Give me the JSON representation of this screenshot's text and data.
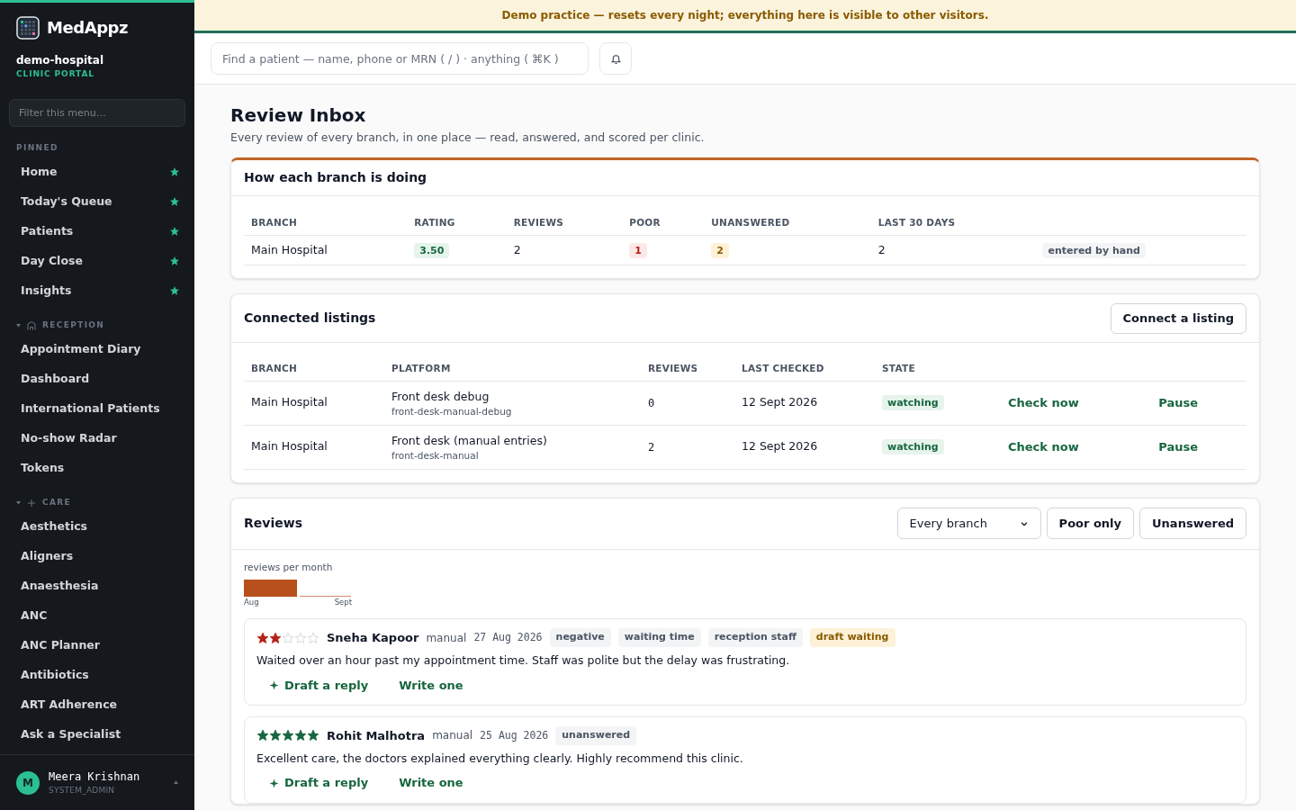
{
  "sidebar": {
    "brand": "MedAppz",
    "org": "demo-hospital",
    "portal": "CLINIC PORTAL",
    "filter_placeholder": "Filter this menu…",
    "sections": [
      {
        "title": "PINNED",
        "kind": "pinned",
        "items": [
          {
            "label": "Home",
            "pinned": true
          },
          {
            "label": "Today's Queue",
            "pinned": true
          },
          {
            "label": "Patients",
            "pinned": true
          },
          {
            "label": "Day Close",
            "pinned": true
          },
          {
            "label": "Insights",
            "pinned": true
          }
        ]
      },
      {
        "title": "RECEPTION",
        "kind": "reception",
        "expanded": true,
        "items": [
          {
            "label": "Appointment Diary"
          },
          {
            "label": "Dashboard"
          },
          {
            "label": "International Patients"
          },
          {
            "label": "No-show Radar"
          },
          {
            "label": "Tokens"
          }
        ]
      },
      {
        "title": "CARE",
        "kind": "care",
        "expanded": true,
        "items": [
          {
            "label": "Aesthetics"
          },
          {
            "label": "Aligners"
          },
          {
            "label": "Anaesthesia"
          },
          {
            "label": "ANC"
          },
          {
            "label": "ANC Planner"
          },
          {
            "label": "Antibiotics"
          },
          {
            "label": "ART Adherence"
          },
          {
            "label": "Ask a Specialist"
          }
        ]
      }
    ],
    "user": {
      "initial": "M",
      "name": "Meera Krishnan",
      "role": "SYSTEM_ADMIN"
    }
  },
  "banner": "Demo practice — resets every night; everything here is visible to other visitors.",
  "search": {
    "placeholder": "Find a patient — name, phone or MRN ( / ) · anything ( ⌘K )"
  },
  "page": {
    "title": "Review Inbox",
    "subtitle": "Every review of every branch, in one place — read, answered, and scored per clinic."
  },
  "branch_card": {
    "title": "How each branch is doing",
    "columns": [
      "BRANCH",
      "RATING",
      "REVIEWS",
      "POOR",
      "UNANSWERED",
      "LAST 30 DAYS"
    ],
    "rows": [
      {
        "branch": "Main Hospital",
        "rating": "3.50",
        "reviews": "2",
        "poor": "1",
        "unanswered": "2",
        "last_30_days": "2",
        "source": "entered by hand"
      }
    ]
  },
  "listings_card": {
    "title": "Connected listings",
    "action": "Connect a listing",
    "columns": [
      "BRANCH",
      "PLATFORM",
      "REVIEWS",
      "LAST CHECKED",
      "STATE"
    ],
    "rows": [
      {
        "branch": "Main Hospital",
        "platform": "Front desk debug",
        "slug": "front-desk-manual-debug",
        "reviews": "0",
        "last_checked": "12 Sept 2026",
        "state": "watching",
        "actions": [
          "Check now",
          "Pause"
        ]
      },
      {
        "branch": "Main Hospital",
        "platform": "Front desk (manual entries)",
        "slug": "front-desk-manual",
        "reviews": "2",
        "last_checked": "12 Sept 2026",
        "state": "watching",
        "actions": [
          "Check now",
          "Pause"
        ]
      }
    ]
  },
  "reviews_card": {
    "title": "Reviews",
    "branch_select": "Every branch",
    "filters": [
      {
        "label": "Poor only",
        "selected": false
      },
      {
        "label": "Unanswered",
        "selected": false
      }
    ],
    "monthly_chart": {
      "title": "reviews per month",
      "labels": [
        "Aug",
        "Sept"
      ]
    },
    "reviews": [
      {
        "stars": 2,
        "author": "Sneha Kapoor",
        "source": "manual",
        "date": "27 Aug 2026",
        "tags": [
          {
            "label": "negative",
            "kind": "plain"
          },
          {
            "label": "waiting time",
            "kind": "plain"
          },
          {
            "label": "reception staff",
            "kind": "plain"
          },
          {
            "label": "draft waiting",
            "kind": "warning"
          }
        ],
        "text": "Waited over an hour past my appointment time. Staff was polite but the delay was frustrating.",
        "actions": [
          "Draft a reply",
          "Write one"
        ]
      },
      {
        "stars": 5,
        "author": "Rohit Malhotra",
        "source": "manual",
        "date": "25 Aug 2026",
        "tags": [
          {
            "label": "unanswered",
            "kind": "plain"
          }
        ],
        "text": "Excellent care, the doctors explained everything clearly. Highly recommend this clinic.",
        "actions": [
          "Draft a reply",
          "Write one"
        ]
      }
    ]
  }
}
